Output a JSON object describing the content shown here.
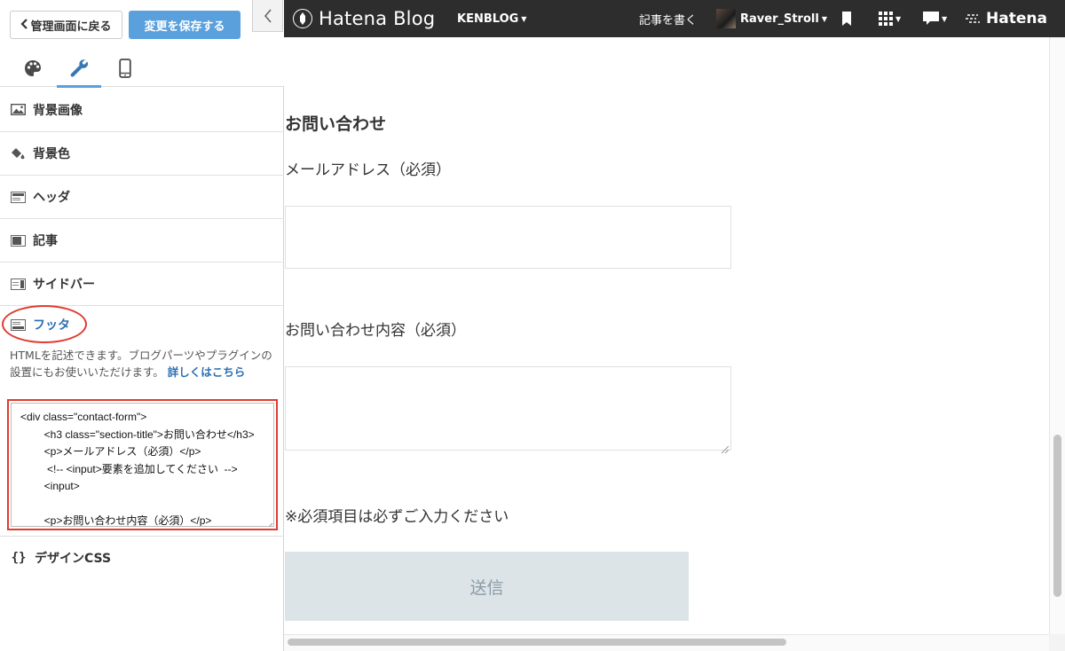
{
  "panel": {
    "back_label": "管理画面に戻る",
    "save_label": "変更を保存する",
    "tabs": [
      {
        "name": "theme",
        "icon": "palette-icon"
      },
      {
        "name": "customize",
        "icon": "wrench-icon"
      },
      {
        "name": "smartphone",
        "icon": "smartphone-icon"
      }
    ],
    "sections": [
      {
        "label": "背景画像",
        "icon": "image-icon"
      },
      {
        "label": "背景色",
        "icon": "paint-bucket-icon"
      },
      {
        "label": "ヘッダ",
        "icon": "layout-header-icon"
      },
      {
        "label": "記事",
        "icon": "layout-article-icon"
      },
      {
        "label": "サイドバー",
        "icon": "layout-sidebar-icon"
      },
      {
        "label": "フッタ",
        "icon": "layout-footer-icon"
      },
      {
        "label": "デザインCSS",
        "icon": "braces-icon"
      }
    ],
    "footer": {
      "description": "HTMLを記述できます。ブログパーツやプラグインの設置にもお使いいただけます。",
      "link_text": "詳しくはこちら",
      "code": "<div class=\"contact-form\">\n        <h3 class=\"section-title\">お問い合わせ</h3>\n        <p>メールアドレス（必須）</p>\n         <!-- <input>要素を追加してください  -->\n        <input>\n\n        <p>お問い合わせ内容（必須）</p>\n         <!-- <textarea>要素を追加してください -->"
    }
  },
  "topbar": {
    "logo": "Hatena Blog",
    "blog_name": "KENBLOG",
    "write_label": "記事を書く",
    "username": "Raver_Stroll",
    "brand": "Hatena"
  },
  "preview": {
    "form_title": "お問い合わせ",
    "email_label": "メールアドレス（必須）",
    "message_label": "お問い合わせ内容（必須）",
    "required_note": "※必須項目は必ずご入力ください",
    "submit_label": "送信"
  },
  "colors": {
    "accent": "#5aa0dc",
    "highlight": "#e03c31",
    "topbar": "#2d2d2d",
    "link": "#2d6fb3"
  }
}
